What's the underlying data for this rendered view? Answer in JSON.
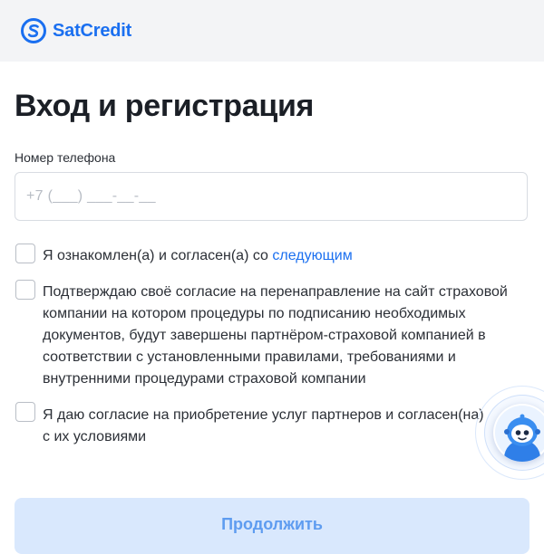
{
  "header": {
    "logo_text": "SatCredit",
    "brand_color": "#1a6ff0"
  },
  "title": "Вход и регистрация",
  "phone": {
    "label": "Номер телефона",
    "placeholder": "+7 (___) ___-__-__",
    "value": ""
  },
  "consents": [
    {
      "text": "Я ознакомлен(а) и согласен(а) со ",
      "link": "следующим",
      "checked": false
    },
    {
      "text": "Подтверждаю своё согласие на перенаправление на сайт страховой компании на котором процедуры по подписанию необходимых документов, будут завершены партнёром-страховой компанией в соответствии с установленными правилами, требованиями и внутренними процедурами страховой компании",
      "checked": false
    },
    {
      "text": "Я даю согласие на приобретение услуг партнеров и согласен(на) с их условиями",
      "checked": false
    }
  ],
  "submit_label": "Продолжить",
  "chat_widget": {
    "icon": "robot-assistant-icon"
  }
}
